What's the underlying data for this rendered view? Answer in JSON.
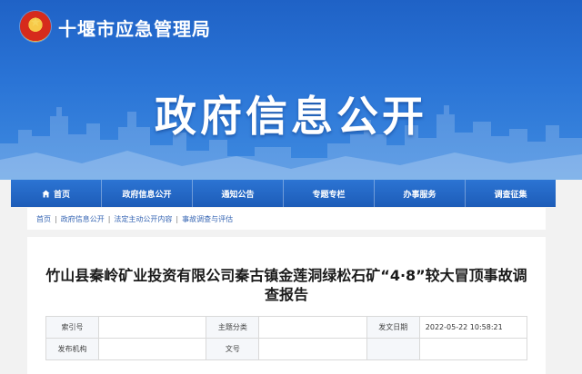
{
  "header": {
    "agency_name": "十堰市应急管理局",
    "banner_title": "政府信息公开"
  },
  "nav": {
    "items": [
      {
        "label": "首页",
        "icon": "home-icon"
      },
      {
        "label": "政府信息公开"
      },
      {
        "label": "通知公告"
      },
      {
        "label": "专题专栏"
      },
      {
        "label": "办事服务"
      },
      {
        "label": "调查征集"
      }
    ]
  },
  "breadcrumb": [
    "首页",
    "政府信息公开",
    "法定主动公开内容",
    "事故调查与评估"
  ],
  "document": {
    "title": "竹山县秦岭矿业投资有限公司秦古镇金莲洞绿松石矿“4·8”较大冒顶事故调查报告",
    "meta": {
      "index_label": "索引号",
      "index_value": "",
      "subject_label": "主题分类",
      "subject_value": "",
      "date_label": "发文日期",
      "date_value": "2022-05-22 10:58:21",
      "issuer_label": "发布机构",
      "issuer_value": "",
      "docno_label": "文号",
      "docno_value": ""
    }
  },
  "colors": {
    "banner_blue": "#2a74d6",
    "nav_blue": "#1d5cb8",
    "link_blue": "#3867b4"
  }
}
